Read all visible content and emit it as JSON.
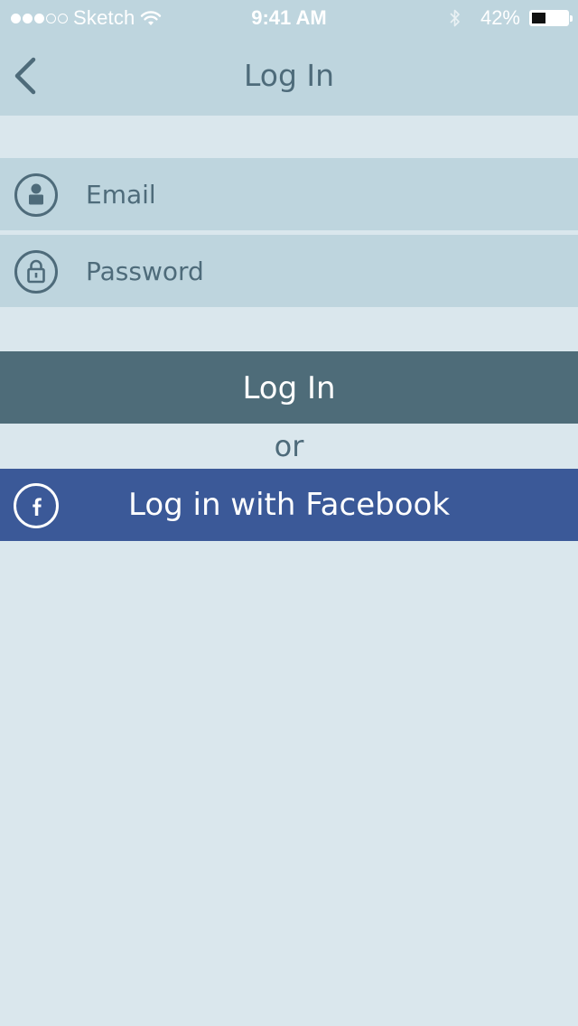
{
  "status_bar": {
    "signal_filled": 3,
    "signal_total": 5,
    "carrier": "Sketch",
    "time": "9:41 AM",
    "battery_percent_text": "42%",
    "battery_level": 0.42
  },
  "nav": {
    "title": "Log In",
    "back_icon": "chevron-left-icon"
  },
  "form": {
    "email_placeholder": "Email",
    "email_value": "",
    "email_icon": "user-icon",
    "password_placeholder": "Password",
    "password_value": "",
    "password_icon": "lock-icon"
  },
  "actions": {
    "login_label": "Log In",
    "or_text": "or",
    "facebook_label": "Log in with Facebook",
    "facebook_icon": "facebook-icon"
  },
  "colors": {
    "background": "#dae7ed",
    "bar": "#bed5de",
    "text": "#4e6b7a",
    "login_button": "#4e6c79",
    "facebook_button": "#3b5998"
  }
}
